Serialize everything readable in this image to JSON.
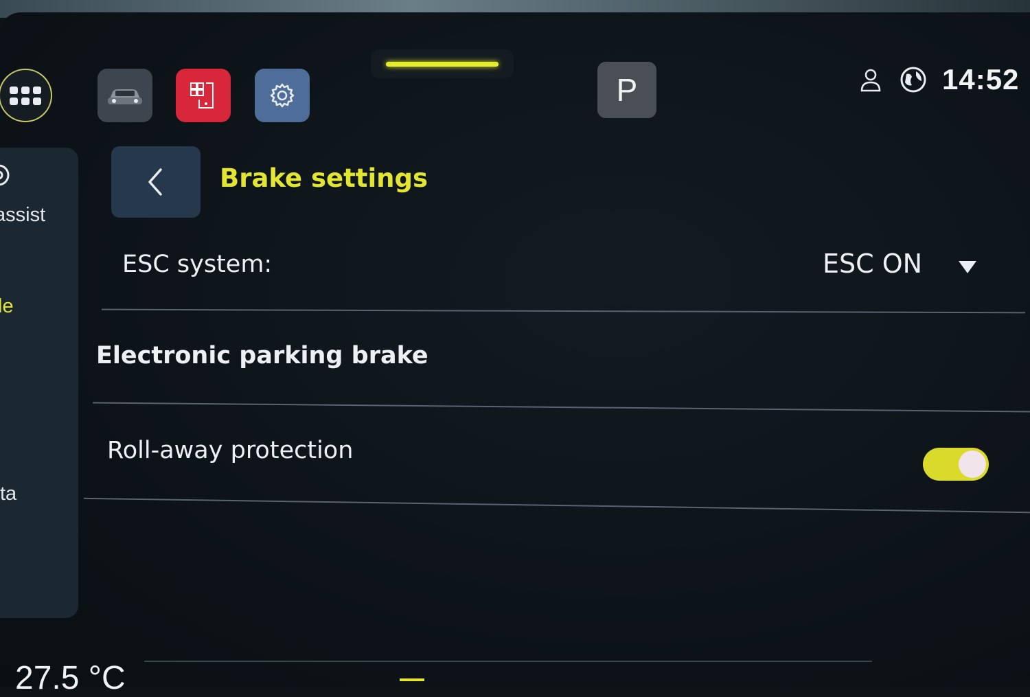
{
  "topbar": {
    "clock": "14:52",
    "gear_indicator": "P",
    "tiles": [
      {
        "name": "vehicle",
        "icon": "car-icon",
        "color": "#3d464e"
      },
      {
        "name": "phone",
        "icon": "phone-icon",
        "color": "#d8263b"
      },
      {
        "name": "settings",
        "icon": "gear-icon",
        "color": "#4e6e99"
      }
    ],
    "status_icons": [
      "user-profile-icon",
      "globe-icon"
    ]
  },
  "sidebar": {
    "items": [
      {
        "label": "assist",
        "active": false
      },
      {
        "label": "le",
        "active": true
      },
      {
        "label": "ta",
        "active": false
      }
    ]
  },
  "header": {
    "title": "Brake settings",
    "back_icon": "chevron-left-icon"
  },
  "settings": {
    "esc": {
      "label": "ESC system:",
      "value": "ESC ON"
    },
    "section_heading": "Electronic parking brake",
    "roll_away": {
      "label": "Roll-away protection",
      "enabled": true
    }
  },
  "bottom": {
    "temperature": "27.5 °C"
  },
  "colors": {
    "accent": "#e3e631",
    "toggle_on": "#d9da2a",
    "background": "#0e1318"
  }
}
